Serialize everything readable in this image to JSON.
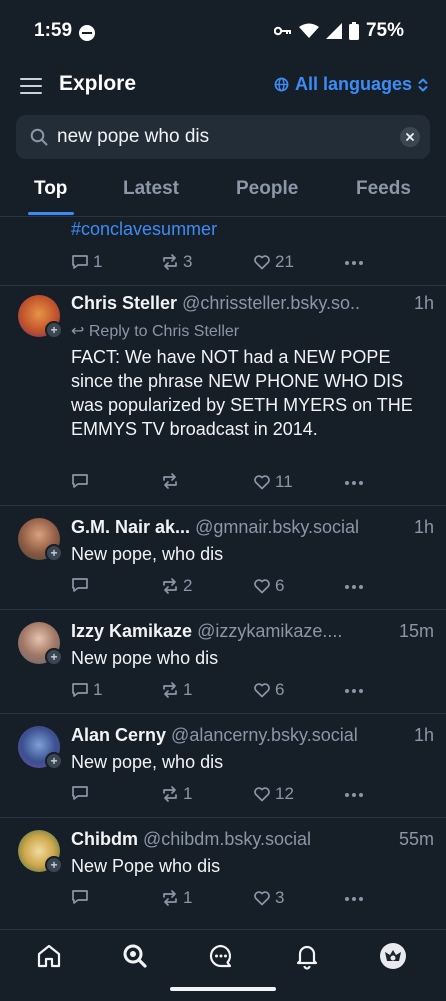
{
  "status_bar": {
    "time": "1:59",
    "battery": "75%"
  },
  "header": {
    "title": "Explore",
    "language_label": "All languages"
  },
  "search": {
    "query": "new pope who dis"
  },
  "tabs": [
    {
      "label": "Top"
    },
    {
      "label": "Latest"
    },
    {
      "label": "People"
    },
    {
      "label": "Feeds"
    }
  ],
  "posts": [
    {
      "body": "#conclavesummer",
      "replies": "1",
      "reposts": "3",
      "likes": "21"
    },
    {
      "author": "Chris Steller",
      "handle": "@chrissteller.bsky.so..",
      "time": "1h",
      "reply_to": "Reply to Chris Steller",
      "body": "FACT: We have NOT had a NEW POPE since the phrase NEW PHONE WHO DIS was popularized by SETH MYERS on THE EMMYS TV broadcast in 2014.",
      "replies": "",
      "reposts": "",
      "likes": "11"
    },
    {
      "author": "G.M. Nair ak...",
      "handle": "@gmnair.bsky.social",
      "time": "1h",
      "body": "New pope, who dis",
      "replies": "",
      "reposts": "2",
      "likes": "6"
    },
    {
      "author": "Izzy Kamikaze",
      "handle": "@izzykamikaze....",
      "time": "15m",
      "body": "New pope who dis",
      "replies": "1",
      "reposts": "1",
      "likes": "6"
    },
    {
      "author": "Alan Cerny",
      "handle": "@alancerny.bsky.social",
      "time": "1h",
      "body": "New pope, who dis",
      "replies": "",
      "reposts": "1",
      "likes": "12"
    },
    {
      "author": "Chibdm",
      "handle": "@chibdm.bsky.social",
      "time": "55m",
      "body": "New Pope who dis",
      "replies": "",
      "reposts": "1",
      "likes": "3"
    }
  ],
  "icons": {
    "menu": "hamburger-menu-icon",
    "globe": "globe-icon",
    "search": "search-icon",
    "clear": "close-icon",
    "reply": "reply-icon",
    "repost": "repost-icon",
    "like": "heart-icon",
    "more": "more-icon",
    "nav": [
      "home-icon",
      "search-icon",
      "chat-icon",
      "bell-icon",
      "profile-avatar"
    ]
  },
  "colors": {
    "background": "#161e27",
    "accent": "#3d8cf5",
    "muted": "#8a97a6",
    "text": "#f1f3f5"
  }
}
